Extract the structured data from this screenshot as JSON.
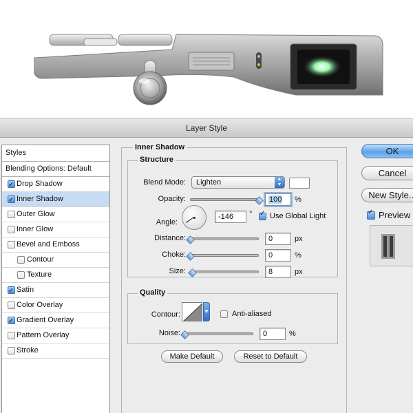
{
  "dialog": {
    "title": "Layer Style"
  },
  "styles_list": {
    "header": "Styles",
    "blending_options": "Blending Options: Default",
    "items": [
      {
        "label": "Drop Shadow",
        "checked": true,
        "selected": false,
        "sub": false
      },
      {
        "label": "Inner Shadow",
        "checked": true,
        "selected": true,
        "sub": false
      },
      {
        "label": "Outer Glow",
        "checked": false,
        "selected": false,
        "sub": false
      },
      {
        "label": "Inner Glow",
        "checked": false,
        "selected": false,
        "sub": false
      },
      {
        "label": "Bevel and Emboss",
        "checked": false,
        "selected": false,
        "sub": false
      },
      {
        "label": "Contour",
        "checked": false,
        "selected": false,
        "sub": true
      },
      {
        "label": "Texture",
        "checked": false,
        "selected": false,
        "sub": true
      },
      {
        "label": "Satin",
        "checked": true,
        "selected": false,
        "sub": false
      },
      {
        "label": "Color Overlay",
        "checked": false,
        "selected": false,
        "sub": false
      },
      {
        "label": "Gradient Overlay",
        "checked": true,
        "selected": false,
        "sub": false
      },
      {
        "label": "Pattern Overlay",
        "checked": false,
        "selected": false,
        "sub": false
      },
      {
        "label": "Stroke",
        "checked": false,
        "selected": false,
        "sub": false
      }
    ]
  },
  "panel": {
    "title": "Inner Shadow",
    "structure": {
      "title": "Structure",
      "blend_mode_label": "Blend Mode:",
      "blend_mode_value": "Lighten",
      "opacity_label": "Opacity:",
      "opacity_value": "100",
      "opacity_unit": "%",
      "opacity_level": 100,
      "angle_label": "Angle:",
      "angle_value": "-146",
      "angle_unit": "°",
      "angle_degrees": -146,
      "use_global_light_label": "Use Global Light",
      "use_global_light": true,
      "distance_label": "Distance:",
      "distance_value": "0",
      "distance_unit": "px",
      "distance_level": 0,
      "choke_label": "Choke:",
      "choke_value": "0",
      "choke_unit": "%",
      "choke_level": 0,
      "size_label": "Size:",
      "size_value": "8",
      "size_unit": "px",
      "size_level": 3
    },
    "quality": {
      "title": "Quality",
      "contour_label": "Contour:",
      "anti_aliased_label": "Anti-aliased",
      "anti_aliased": false,
      "noise_label": "Noise:",
      "noise_value": "0",
      "noise_unit": "%",
      "noise_level": 0
    },
    "make_default_label": "Make Default",
    "reset_default_label": "Reset to Default"
  },
  "buttons": {
    "ok": "OK",
    "cancel": "Cancel",
    "new_style": "New Style...",
    "preview_label": "Preview",
    "preview_checked": true
  },
  "colors": {
    "accent": "#5ea1e8",
    "selection": "#c7dcf3"
  }
}
